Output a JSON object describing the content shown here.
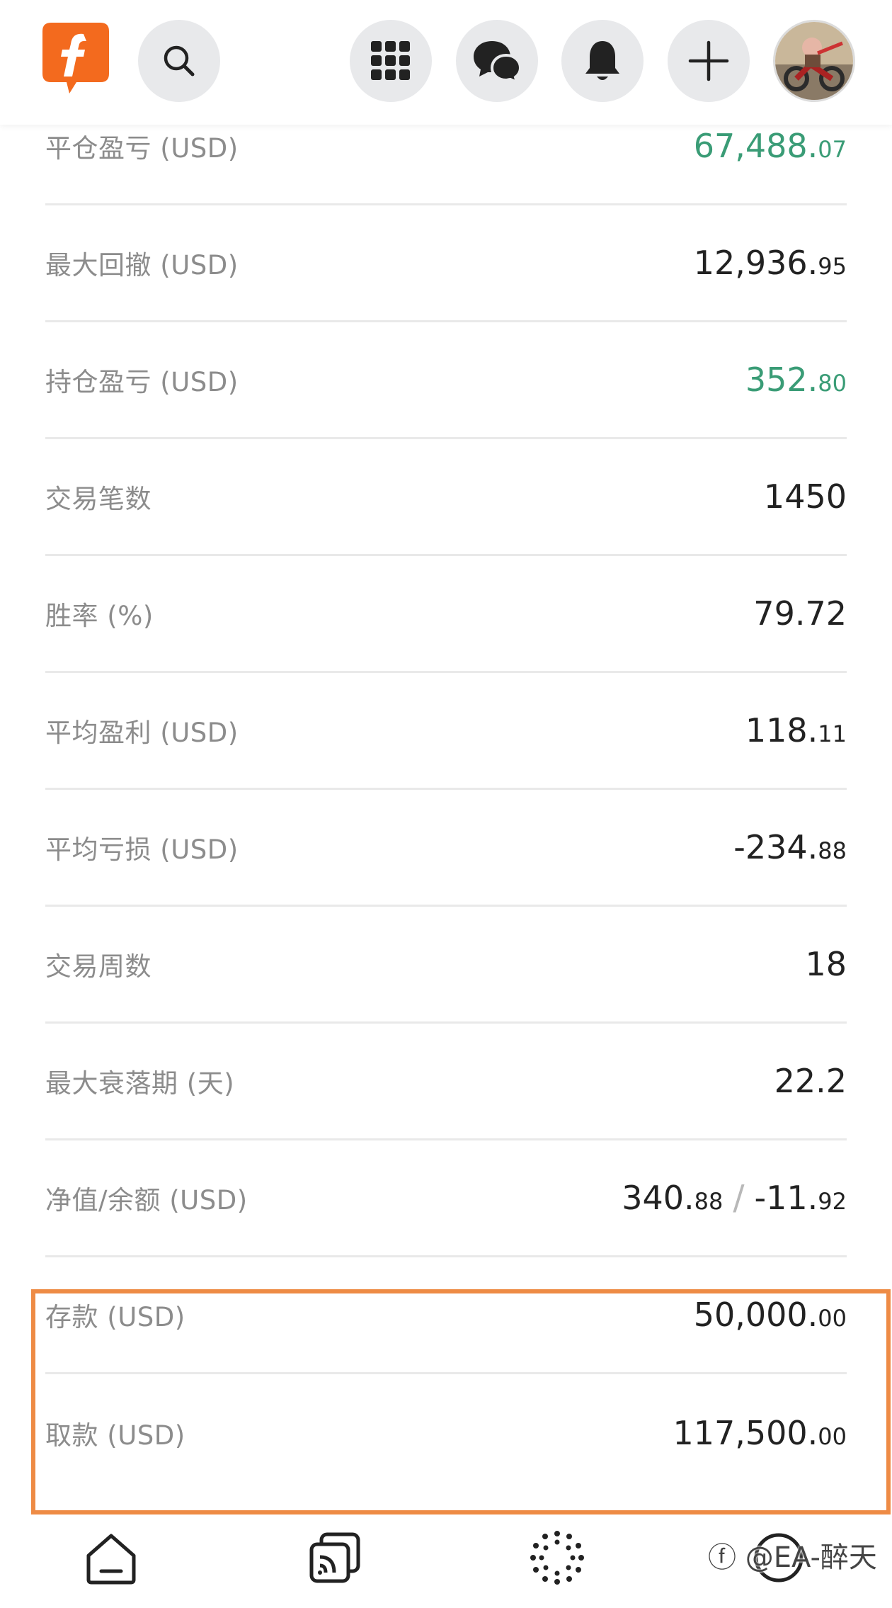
{
  "header": {
    "logo_letter": "f",
    "accent_color": "#f36a1e",
    "icons": [
      "search-icon",
      "apps-grid-icon",
      "chat-icon",
      "bell-icon",
      "plus-icon"
    ]
  },
  "stats": [
    {
      "label": "平仓盈亏 (USD)",
      "int": "67,488.",
      "dec": "07",
      "color": "green"
    },
    {
      "label": "最大回撤 (USD)",
      "int": "12,936.",
      "dec": "95",
      "color": "default"
    },
    {
      "label": "持仓盈亏 (USD)",
      "int": "352.",
      "dec": "80",
      "color": "green"
    },
    {
      "label": "交易笔数",
      "int": "1450",
      "dec": "",
      "color": "default"
    },
    {
      "label": "胜率 (%)",
      "int": "79.72",
      "dec": "",
      "color": "default"
    },
    {
      "label": "平均盈利 (USD)",
      "int": "118.",
      "dec": "11",
      "color": "default"
    },
    {
      "label": "平均亏损 (USD)",
      "int": "-234.",
      "dec": "88",
      "color": "default"
    },
    {
      "label": "交易周数",
      "int": "18",
      "dec": "",
      "color": "default"
    },
    {
      "label": "最大衰落期 (天)",
      "int": "22.2",
      "dec": "",
      "color": "default"
    }
  ],
  "equity_row": {
    "label": "净值/余额 (USD)",
    "equity_int": "340.",
    "equity_dec": "88",
    "separator": "/",
    "balance_int": "-11.",
    "balance_dec": "92"
  },
  "highlighted": [
    {
      "label": "存款 (USD)",
      "int": "50,000.",
      "dec": "00"
    },
    {
      "label": "取款 (USD)",
      "int": "117,500.",
      "dec": "00"
    }
  ],
  "colors": {
    "green": "#3a9c76",
    "highlight_border": "#ee8b45"
  },
  "bottom_nav": {
    "icons": [
      "home-icon",
      "feed-icon",
      "explore-icon",
      "profile-icon"
    ]
  },
  "watermark": "ⓕ @EA-醉天"
}
